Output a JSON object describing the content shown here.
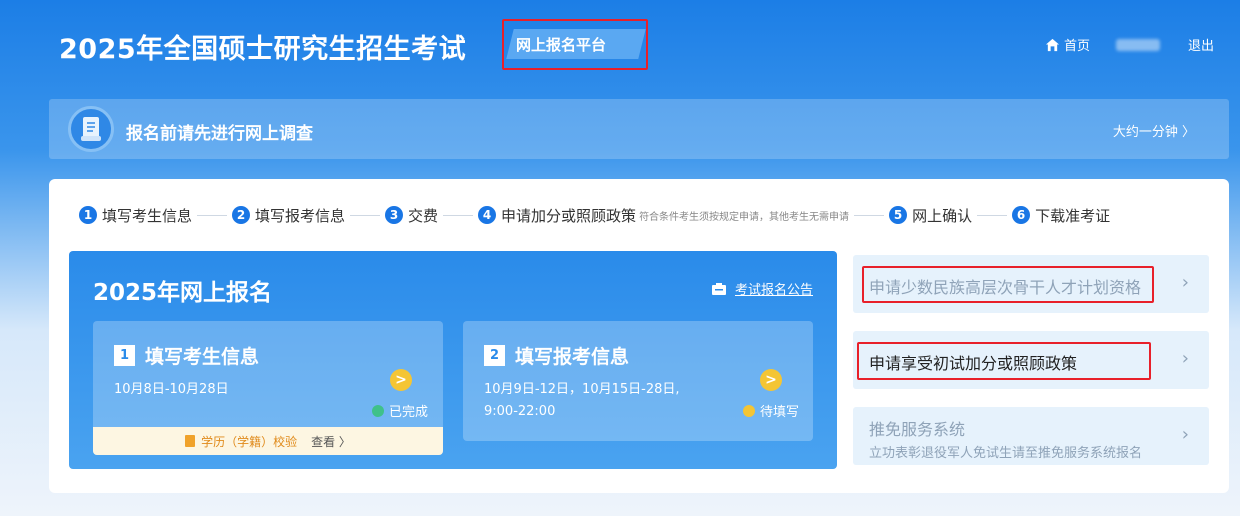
{
  "header": {
    "site_title": "2025年全国硕士研究生招生考试",
    "platform_label": "网上报名平台",
    "nav": {
      "home_label": "首页",
      "logout_label": "退出"
    }
  },
  "survey": {
    "text": "报名前请先进行网上调查",
    "time_label": "大约一分钟 〉"
  },
  "steps": [
    {
      "num": "1",
      "label": "填写考生信息"
    },
    {
      "num": "2",
      "label": "填写报考信息"
    },
    {
      "num": "3",
      "label": "交费"
    },
    {
      "num": "4",
      "label": "申请加分或照顾政策",
      "note": "符合条件考生须按规定申请，其他考生无需申请"
    },
    {
      "num": "5",
      "label": "网上确认"
    },
    {
      "num": "6",
      "label": "下载准考证"
    }
  ],
  "registration": {
    "title": "2025年网上报名",
    "notice_label": "考试报名公告",
    "cards": [
      {
        "num": "1",
        "title": "填写考生信息",
        "date_line1": "10月8日-10月28日",
        "date_line2": "",
        "status": "已完成",
        "arrow": ">",
        "footer_text": "学历（学籍）校验",
        "footer_link": "查看 〉"
      },
      {
        "num": "2",
        "title": "填写报考信息",
        "date_line1": "10月9日-12日，10月15日-28日,",
        "date_line2": "9:00-22:00",
        "status": "待填写",
        "arrow": ">"
      }
    ]
  },
  "policies": [
    {
      "label": "申请少数民族高层次骨干人才计划资格",
      "chevron": "›"
    },
    {
      "label": "申请享受初试加分或照顾政策",
      "chevron": "›"
    },
    {
      "label": "推免服务系统",
      "sub": "立功表彰退役军人免试生请至推免服务系统报名",
      "chevron": "›"
    }
  ],
  "colors": {
    "primary_blue": "#1976e5",
    "highlight_red": "#e8202a",
    "done_green": "#3fc18a",
    "pending_yellow": "#f4c534"
  },
  "icons": [
    "home-icon",
    "scroll-icon",
    "notice-icon",
    "check-circle-icon",
    "pending-dot-icon",
    "document-icon",
    "chevron-right-icon"
  ]
}
